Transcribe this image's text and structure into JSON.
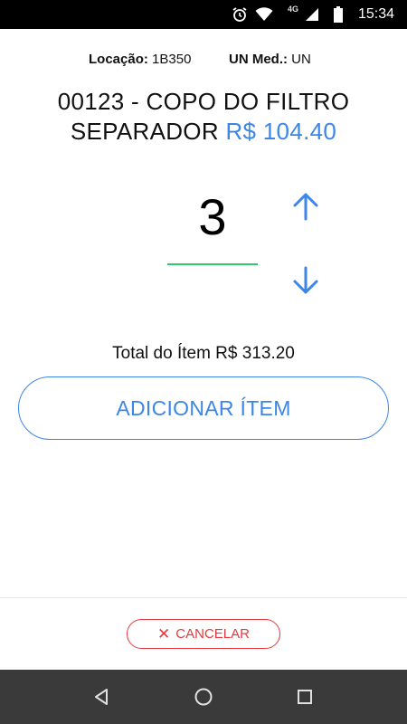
{
  "status_bar": {
    "network": "4G",
    "time": "15:34"
  },
  "info": {
    "location_label": "Locação:",
    "location_value": "1B350",
    "unit_label": "UN Med.:",
    "unit_value": "UN"
  },
  "product": {
    "name_line1": "00123 - COPO DO FILTRO",
    "name_line2": "SEPARADOR",
    "price": "R$ 104.40"
  },
  "quantity": {
    "value": "3"
  },
  "total": {
    "text": "Total do Ítem R$ 313.20"
  },
  "actions": {
    "add_label": "ADICIONAR ÍTEM",
    "cancel_label": "CANCELAR"
  },
  "colors": {
    "accent": "#3b86e6",
    "danger": "#e8383d",
    "underline": "#2ecc71"
  }
}
